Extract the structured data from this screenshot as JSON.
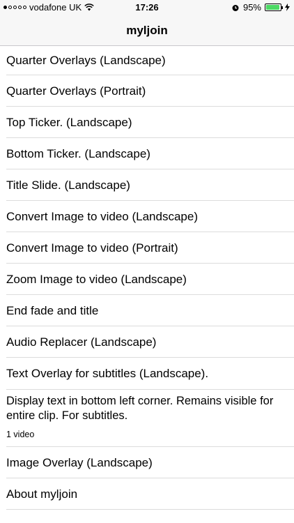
{
  "status": {
    "carrier": "vodafone UK",
    "time": "17:26",
    "battery": "95%",
    "battery_level": 0.95
  },
  "nav": {
    "title": "myljoin"
  },
  "items": [
    "Quarter Overlays (Landscape)",
    "Quarter Overlays (Portrait)",
    "Top Ticker. (Landscape)",
    "Bottom Ticker. (Landscape)",
    "Title Slide. (Landscape)",
    "Convert Image to video (Landscape)",
    "Convert Image to video (Portrait)",
    "Zoom Image to video (Landscape)",
    "End fade and title",
    "Audio Replacer (Landscape)",
    "Text Overlay for subtitles (Landscape)."
  ],
  "selected_detail": {
    "description": "Display text in bottom left corner. Remains visible for entire clip. For subtitles.",
    "meta": "1 video"
  },
  "items_after": [
    "Image Overlay (Landscape)",
    "About myljoin"
  ]
}
